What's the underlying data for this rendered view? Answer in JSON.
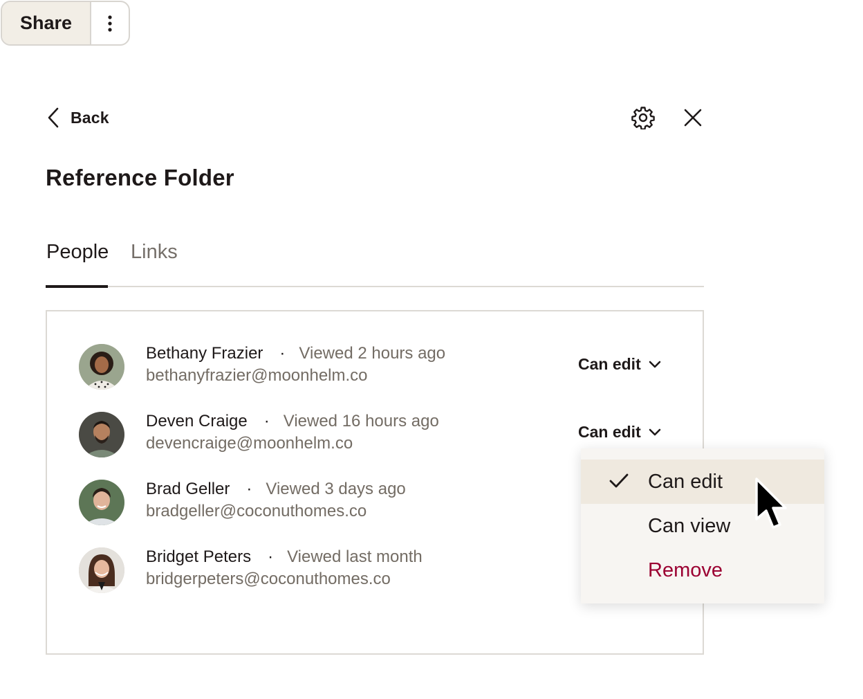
{
  "share": {
    "label": "Share"
  },
  "header": {
    "back_label": "Back",
    "title": "Reference Folder"
  },
  "tabs": [
    {
      "label": "People",
      "active": true
    },
    {
      "label": "Links",
      "active": false
    }
  ],
  "people": [
    {
      "name": "Bethany Frazier",
      "separator": "·",
      "viewed": "Viewed 2 hours ago",
      "email": "bethanyfrazier@moonhelm.co",
      "permission": "Can edit"
    },
    {
      "name": "Deven Craige",
      "separator": "·",
      "viewed": "Viewed 16 hours ago",
      "email": "devencraige@moonhelm.co",
      "permission": "Can edit"
    },
    {
      "name": "Brad Geller",
      "separator": "·",
      "viewed": "Viewed 3 days ago",
      "email": "bradgeller@coconuthomes.co",
      "permission": null
    },
    {
      "name": "Bridget Peters",
      "separator": "·",
      "viewed": "Viewed last month",
      "email": "bridgerpeters@coconuthomes.co",
      "permission": null
    }
  ],
  "dropdown": {
    "items": [
      {
        "label": "Can edit",
        "selected": true
      },
      {
        "label": "Can view",
        "selected": false
      },
      {
        "label": "Remove",
        "selected": false
      }
    ]
  },
  "icons": {
    "more": "vertical-dots-icon",
    "back": "chevron-left-icon",
    "settings": "gear-icon",
    "close": "close-icon",
    "permission_caret": "chevron-down-icon",
    "selected": "checkmark-icon",
    "pointer": "mouse-cursor-icon"
  },
  "colors": {
    "share_bg": "#f2eee6",
    "text": "#1e1919",
    "muted": "#736c64",
    "remove": "#9b0032",
    "highlight": "#efe9df",
    "dropdown_bg": "#f7f5f2"
  }
}
